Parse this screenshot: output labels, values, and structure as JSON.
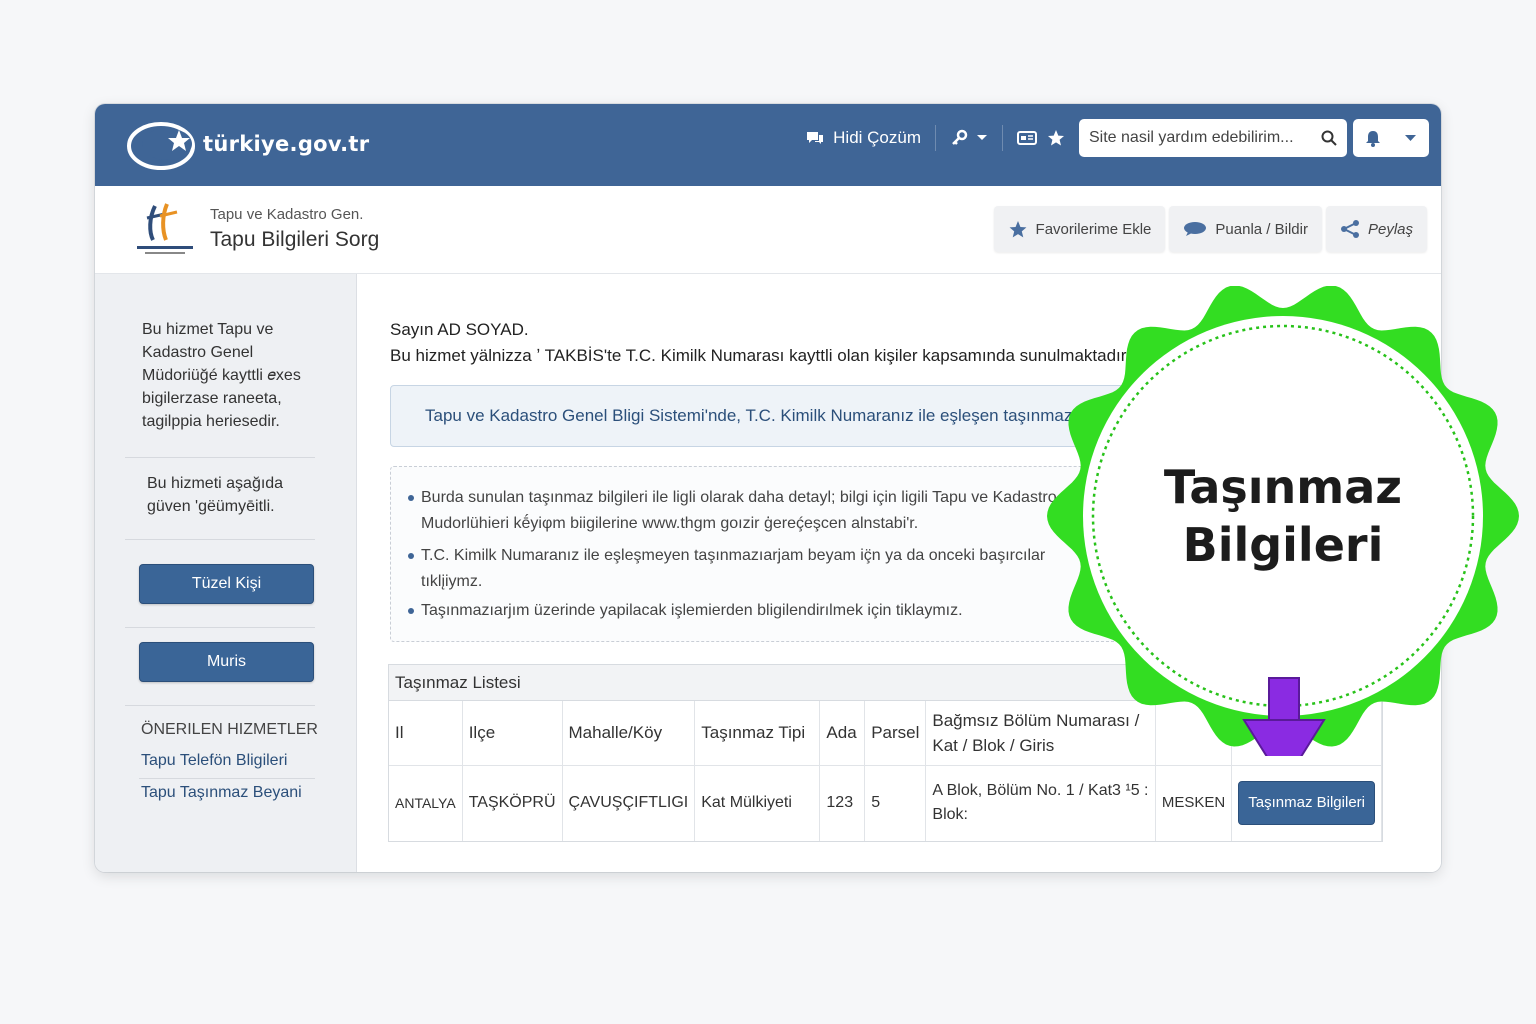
{
  "portal": {
    "logo_text": "türkiye.gov.tr"
  },
  "topnav": {
    "help_label": "Hidi Çozüm",
    "search_placeholder": "Site nasil yardım edebilirim..."
  },
  "institution": {
    "small_name": "Tapu ve Kadastro Gen.",
    "service_title": "Tapu Bilgileri Sorg"
  },
  "actions": {
    "favorite_label": "Favorilerime Ekle",
    "rate_label": "Puanla / Bildir",
    "share_label": "Peylaş"
  },
  "sidebar": {
    "intro_lines": [
      "Bu hizmet Tapu ve",
      "Kadastro Genel",
      "Müdoriüğé kayttli 𝑒xes",
      "bigilerzase raneeta,",
      "tagilppia heriesedir."
    ],
    "secure_lines": [
      "Bu hizmeti aşağıda",
      "güven 'gëümyēitli."
    ],
    "buttons": [
      "Tüzel Kişi",
      "Muris"
    ],
    "recommended_heading": "ÖNERILEN HIZMETLER",
    "links": [
      "Tapu Telefön Bligileri",
      "Tapu Taşınmaz Beyani"
    ]
  },
  "main": {
    "greeting": "Sayın AD SOYAD.",
    "intro": "Bu hizmet yälnizza ʼ TAKBİS'te T.C. Kimilk Numarası kayttli olan kişiler kapsamında sunulmaktadır.",
    "info_text": "Tapu ve Kadastro Genel Bligi Sistemi'nde, T.C. Kimilk Numaranız ile eşleşen taşınmazlar listelenmektedir.",
    "bullets": [
      "Burda sunulan taşınmaz bilgileri ile ligli olarak daha detayl; bilgi için ligili Tapu ve Kadastro",
      "Mudorlühieri kḗyiφm biigilerine www.thgm goızir ģereḉeşcen alnstabi'r.",
      "T.C. Kimilk Numaranız ile eşleşmeyen taşınmazıarjam beyam iç̈n ya da onceki başırcılar",
      "tıklįiymz.",
      "Taşınmazıarjım üzerinde yapilacak işlemierden bligilendirılmek için tiklaymız."
    ]
  },
  "table": {
    "caption": "Taşınmaz Listesi",
    "headers": [
      "Il",
      "Ilçe",
      "Mahalle/Köy",
      "Taşınmaz Tipi",
      "Ada",
      "Parsel",
      "Bağmsız Bölüm Numarası / Kat / Blok / Giris",
      "",
      ""
    ],
    "rows": [
      [
        "ANTALYA",
        "TAŞKÖPRÜ",
        "ÇAVUŞÇIFTLIGI",
        "Kat Mülkiyeti",
        "123",
        "5",
        "A Blok, Bölüm No. 1 / Kat3 ¹5 : Blok:",
        "MESKEN",
        "Taşınmaz Bilgileri"
      ]
    ]
  },
  "callout": {
    "title_line1": "Taşınmaz",
    "title_line2": "Bilgileri",
    "color": "#33dd22",
    "arrow_color": "#8a2be2"
  }
}
